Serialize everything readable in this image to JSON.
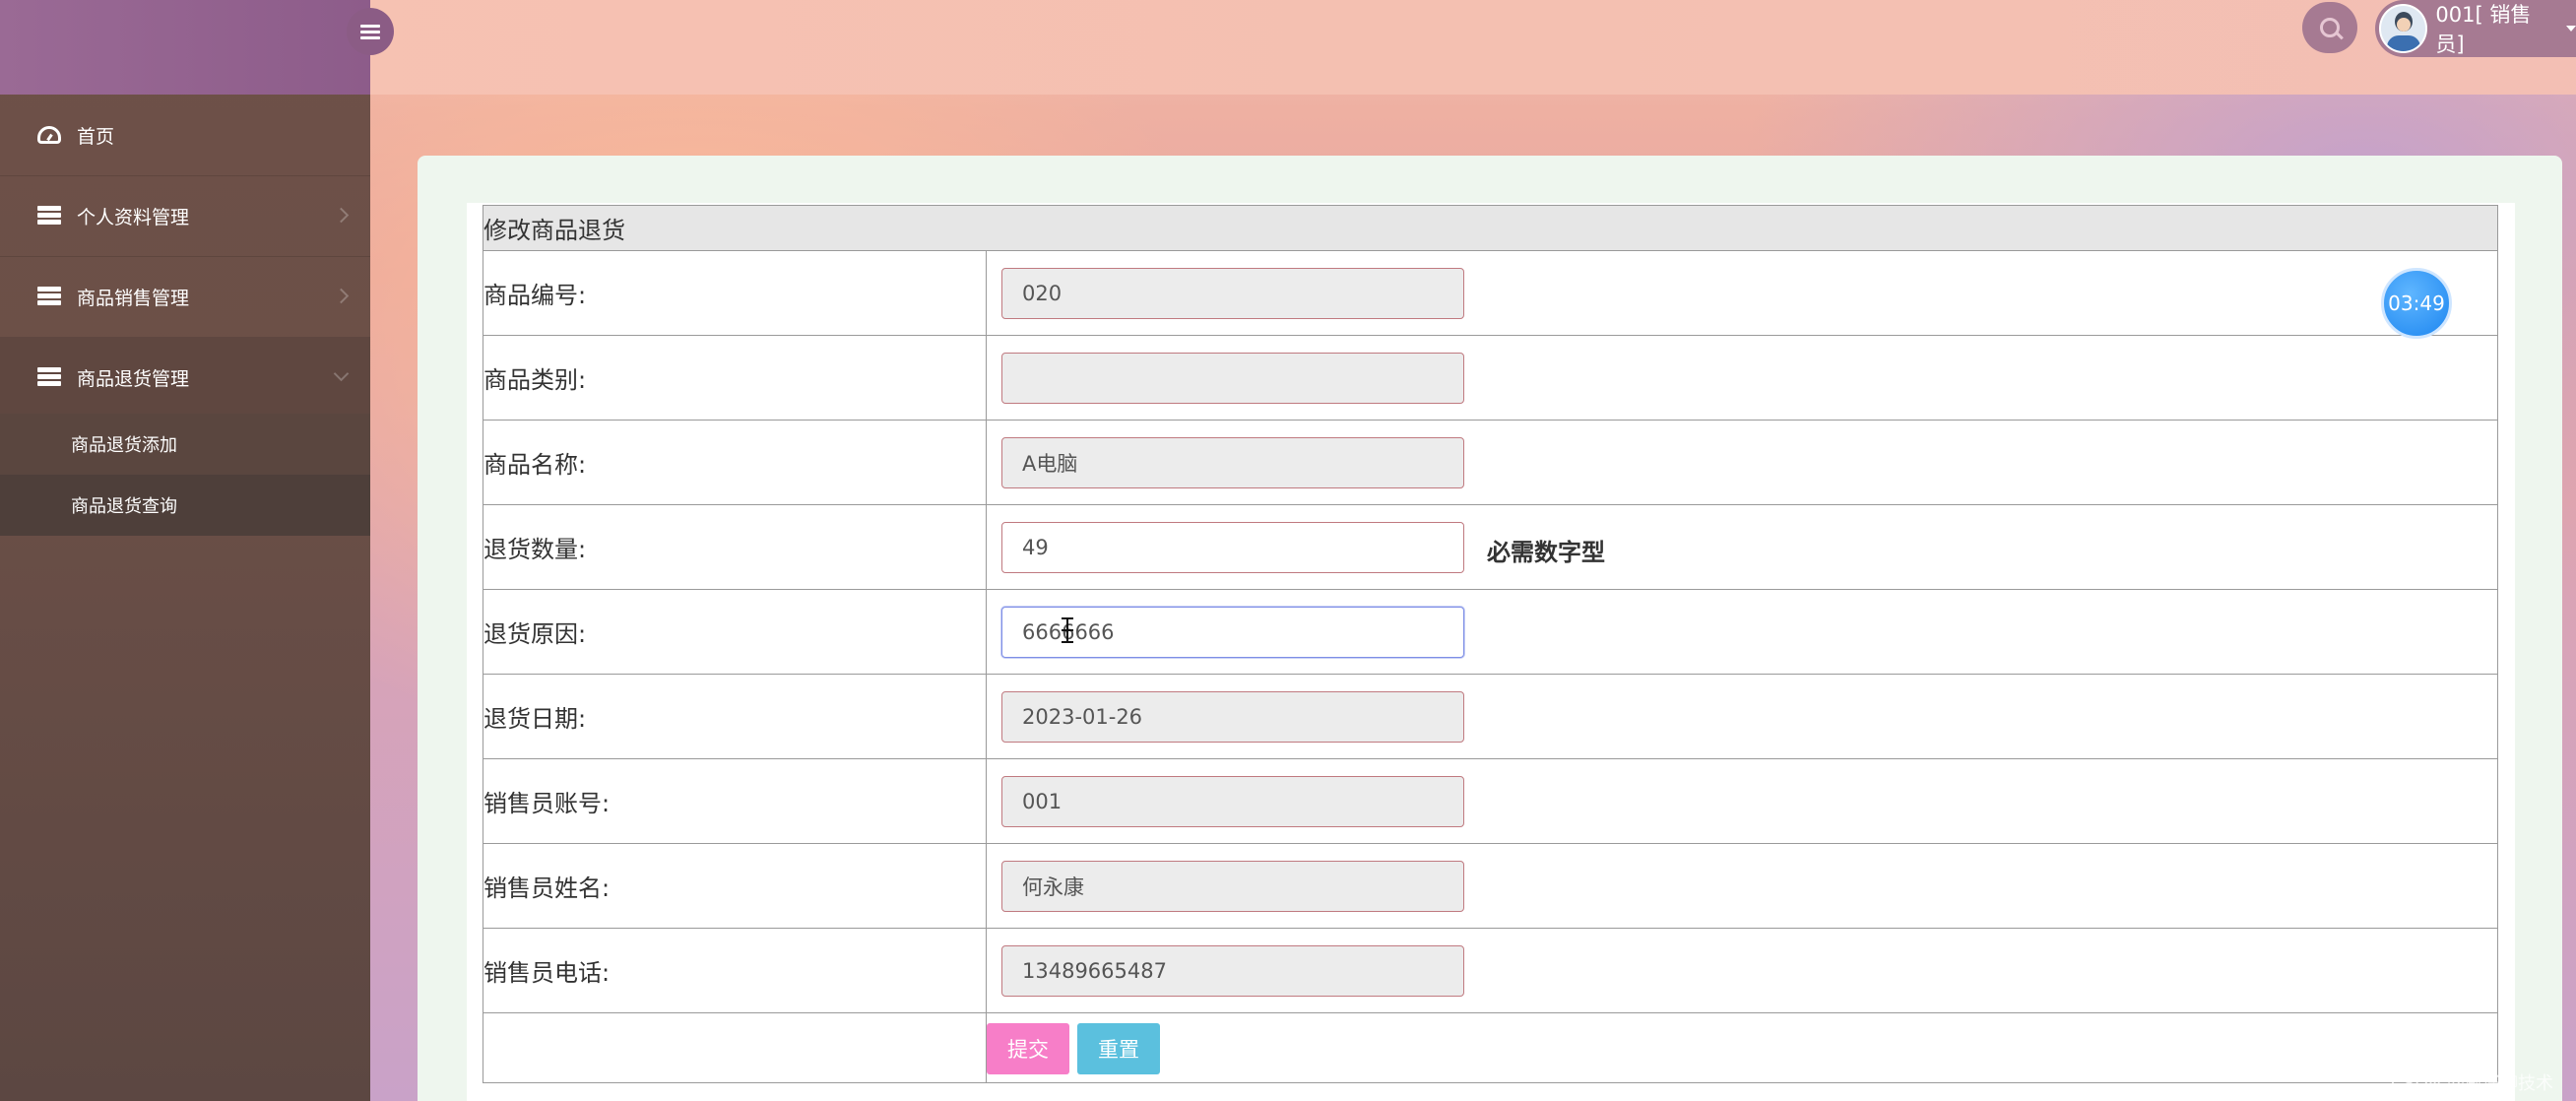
{
  "sidebar": {
    "items": [
      {
        "label": "首页",
        "icon": "dashboard-icon"
      },
      {
        "label": "个人资料管理",
        "icon": "list-icon"
      },
      {
        "label": "商品销售管理",
        "icon": "list-icon"
      },
      {
        "label": "商品退货管理",
        "icon": "list-icon",
        "expanded": true
      }
    ],
    "subitems": [
      {
        "label": "商品退货添加"
      },
      {
        "label": "商品退货查询"
      }
    ]
  },
  "header": {
    "user_label": "001[ 销售员]"
  },
  "form": {
    "title": "修改商品退货",
    "rows": [
      {
        "label": "商品编号:",
        "value": "020",
        "editable": false
      },
      {
        "label": "商品类别:",
        "value": "",
        "editable": false
      },
      {
        "label": "商品名称:",
        "value": "A电脑",
        "editable": false
      },
      {
        "label": "退货数量:",
        "value": "49",
        "editable": true,
        "hint": "必需数字型"
      },
      {
        "label": "退货原因:",
        "value": "6666666",
        "editable": true,
        "focused": true
      },
      {
        "label": "退货日期:",
        "value": "2023-01-26",
        "editable": false
      },
      {
        "label": "销售员账号:",
        "value": "001",
        "editable": false
      },
      {
        "label": "销售员姓名:",
        "value": "何永康",
        "editable": false
      },
      {
        "label": "销售员电话:",
        "value": "13489665487",
        "editable": false
      }
    ],
    "submit_label": "提交",
    "reset_label": "重置"
  },
  "timer": "03:49",
  "watermark": "CSDN @威仔聊技术",
  "colors": {
    "submit": "#f77ec8",
    "reset": "#5bc0de",
    "sidebar": "#6b4f47",
    "sidebar_header": "#8d5c8a"
  }
}
